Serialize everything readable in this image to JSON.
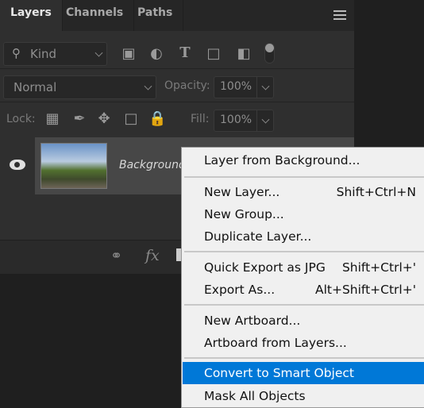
{
  "tabs": [
    {
      "label": "Layers",
      "active": true
    },
    {
      "label": "Channels"
    },
    {
      "label": "Paths"
    }
  ],
  "filter": {
    "kind_label": "Kind",
    "icons": [
      "image-filter-icon",
      "adjustment-filter-icon",
      "type-filter-icon",
      "shape-filter-icon",
      "smart-object-filter-icon",
      "filter-toggle-icon"
    ]
  },
  "blend": {
    "mode": "Normal",
    "opacity_label": "Opacity:",
    "opacity_value": "100%"
  },
  "lock": {
    "label": "Lock:",
    "fill_label": "Fill:",
    "fill_value": "100%"
  },
  "layer": {
    "name": "Background",
    "visible": true
  },
  "context_menu": {
    "highlight_color": "#0078d7",
    "items": [
      {
        "label": "Layer from Background...",
        "shortcut": ""
      },
      {
        "label": "New Layer...",
        "shortcut": "Shift+Ctrl+N"
      },
      {
        "label": "New Group...",
        "shortcut": ""
      },
      {
        "label": "Duplicate Layer...",
        "shortcut": ""
      },
      {
        "label": "Quick Export as JPG",
        "shortcut": "Shift+Ctrl+'"
      },
      {
        "label": "Export As...",
        "shortcut": "Alt+Shift+Ctrl+'"
      },
      {
        "label": "New Artboard...",
        "shortcut": ""
      },
      {
        "label": "Artboard from Layers...",
        "shortcut": ""
      },
      {
        "label": "Convert to Smart Object",
        "shortcut": "",
        "highlighted": true
      },
      {
        "label": "Mask All Objects",
        "shortcut": ""
      }
    ]
  }
}
